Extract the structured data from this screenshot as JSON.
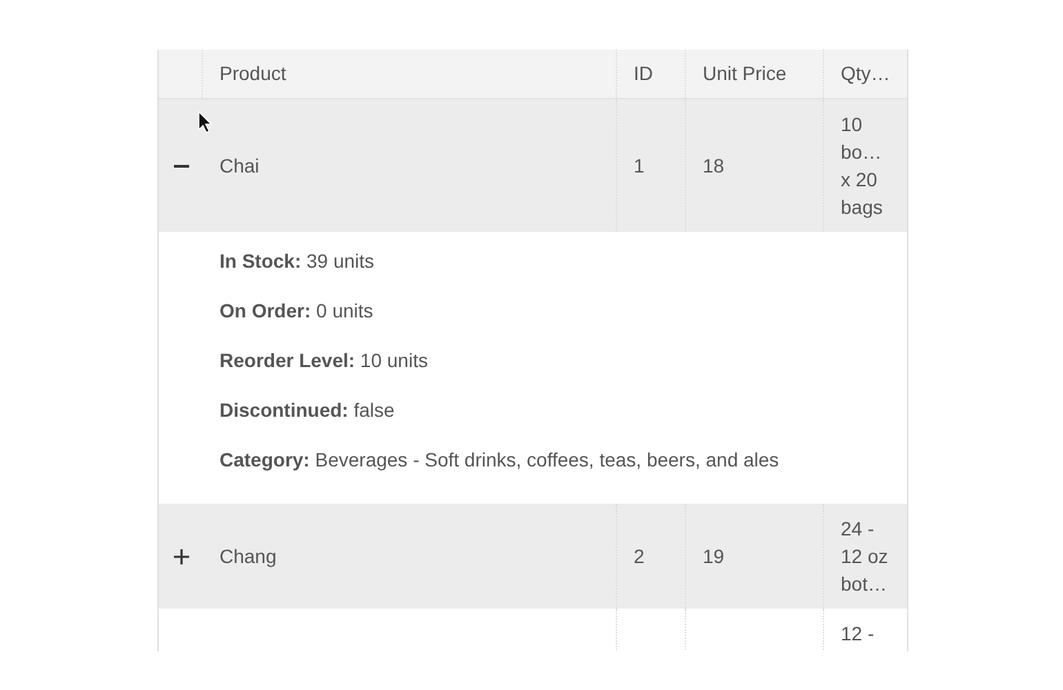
{
  "table": {
    "columns": [
      {
        "label": "Product"
      },
      {
        "label": "ID"
      },
      {
        "label": "Unit Price"
      },
      {
        "label": "Qty…"
      }
    ],
    "rows": [
      {
        "expanded": true,
        "product": "Chai",
        "id": "1",
        "unit_price": "18",
        "qty_lines": [
          "10",
          "bo…",
          "x 20",
          "bags"
        ],
        "details": [
          {
            "label": "In Stock:",
            "value": "39 units"
          },
          {
            "label": "On Order:",
            "value": "0 units"
          },
          {
            "label": "Reorder Level:",
            "value": "10 units"
          },
          {
            "label": "Discontinued:",
            "value": "false"
          },
          {
            "label": "Category:",
            "value": "Beverages - Soft drinks, coffees, teas, beers, and ales"
          }
        ]
      },
      {
        "expanded": false,
        "product": "Chang",
        "id": "2",
        "unit_price": "19",
        "qty_lines": [
          "24 -",
          "12 oz",
          "bot…"
        ]
      },
      {
        "qty_lines": [
          "12 -"
        ]
      }
    ]
  }
}
